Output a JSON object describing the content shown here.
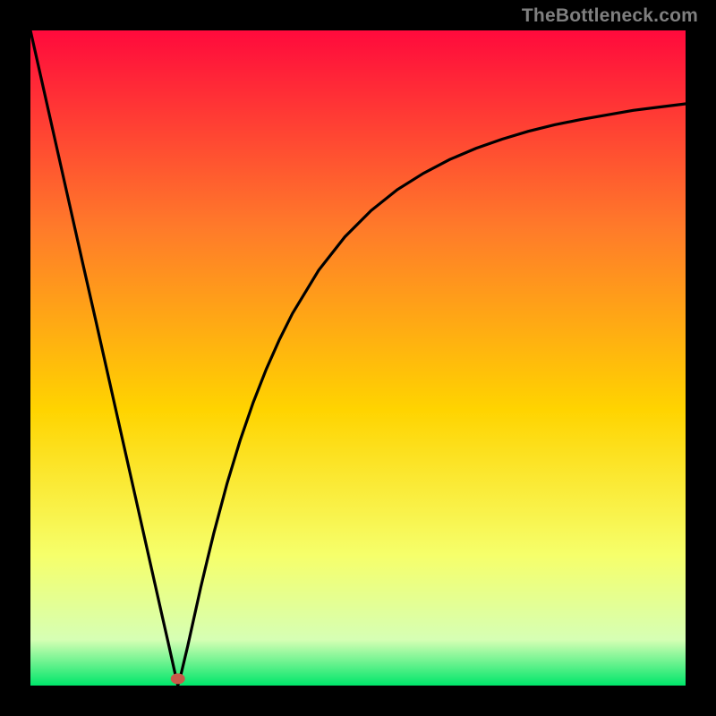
{
  "watermark": "TheBottleneck.com",
  "chart_data": {
    "type": "line",
    "title": "",
    "xlabel": "",
    "ylabel": "",
    "xlim": [
      0,
      100
    ],
    "ylim": [
      0,
      100
    ],
    "gradient_colors": {
      "top": "#ff0a3c",
      "upper_mid": "#ff7a2a",
      "mid": "#ffd400",
      "lower_mid": "#f6ff6a",
      "near_bottom": "#d6ffb4",
      "bottom": "#00e66a"
    },
    "marker": {
      "x": 22.5,
      "y": 0.5,
      "color": "#c85a4a"
    },
    "curve_description": "V-shaped curve: steep straight descent from top-left to a minimum near x≈22, then a concave-upward rise approaching the top-right.",
    "series": [
      {
        "name": "bottleneck-curve",
        "x": [
          0,
          2,
          4,
          6,
          8,
          10,
          12,
          14,
          16,
          18,
          20,
          21,
          22,
          22.5,
          23,
          24,
          25,
          26,
          27,
          28,
          30,
          32,
          34,
          36,
          38,
          40,
          44,
          48,
          52,
          56,
          60,
          64,
          68,
          72,
          76,
          80,
          84,
          88,
          92,
          96,
          100
        ],
        "y": [
          100,
          91.1,
          82.2,
          73.3,
          64.4,
          55.6,
          46.7,
          37.8,
          28.9,
          20.0,
          11.1,
          6.7,
          2.2,
          0.0,
          1.8,
          6.0,
          10.5,
          15.0,
          19.2,
          23.3,
          30.8,
          37.4,
          43.2,
          48.3,
          52.8,
          56.8,
          63.4,
          68.5,
          72.5,
          75.7,
          78.2,
          80.3,
          82.0,
          83.4,
          84.6,
          85.6,
          86.4,
          87.1,
          87.8,
          88.3,
          88.8
        ]
      }
    ]
  }
}
